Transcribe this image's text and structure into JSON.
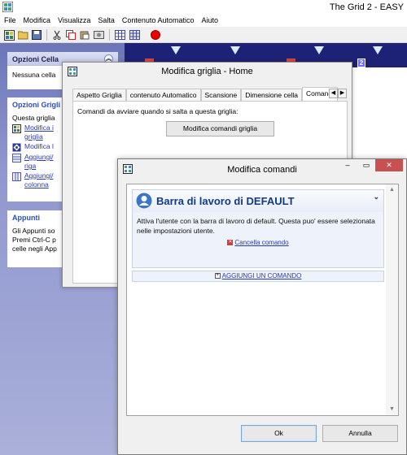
{
  "app": {
    "title": "The Grid 2 - EASY",
    "menu": [
      "File",
      "Modifica",
      "Visualizza",
      "Salta",
      "Contenuto Automatico",
      "Aiuto"
    ]
  },
  "toolbar_icons": [
    "new-icon",
    "open-icon",
    "save-icon",
    "cut-icon",
    "copy-icon",
    "paste-icon",
    "screenshot-icon",
    "grid-view-icon",
    "grid-edit-icon",
    "record-icon"
  ],
  "task_pane": {
    "cell_options": {
      "title": "Opzioni Cella",
      "text": "Nessuna cella"
    },
    "grid_options": {
      "title": "Opzioni Grigli",
      "intro": "Questa griglia",
      "items": [
        {
          "label": "Modifica i griglia",
          "link": true
        },
        {
          "label": "Modifica l",
          "link": false
        },
        {
          "label": "Aggiungi/ riga",
          "link": true
        },
        {
          "label": "Aggiungi/ colonna",
          "link": true
        }
      ]
    },
    "clipboard": {
      "title": "Appunti",
      "lines": [
        "Gli Appunti so",
        "Premi Ctrl-C p",
        "celle negli App"
      ]
    }
  },
  "grid": {
    "badge": "2"
  },
  "dialog_grid": {
    "title": "Modifica griglia - Home",
    "tabs": [
      "Aspetto Griglia",
      "contenuto Automatico",
      "Scansione",
      "Dimensione cella",
      "Comandi"
    ],
    "active_tab": "Comandi",
    "commands_label": "Comandi da avviare quando si salta a questa griglia:",
    "button": "Modifica comandi griglia"
  },
  "dialog_commands": {
    "title": "Modifica comandi",
    "card_title": "Barra di lavoro di DEFAULT",
    "card_text": "Attiva l'utente con la barra di lavoro di default. Questa puo' essere selezionata nelle impostazioni utente.",
    "delete_link": "Cancella comando",
    "add_link": "AGGIUNGI UN COMANDO",
    "ok": "Ok",
    "cancel": "Annulla"
  },
  "colors": {
    "task_pane_gradient_top": "#6c76b8",
    "grid_background": "#1e2276",
    "card_title": "#123a86",
    "close_button": "#c75050",
    "link": "#2a3bb4"
  }
}
